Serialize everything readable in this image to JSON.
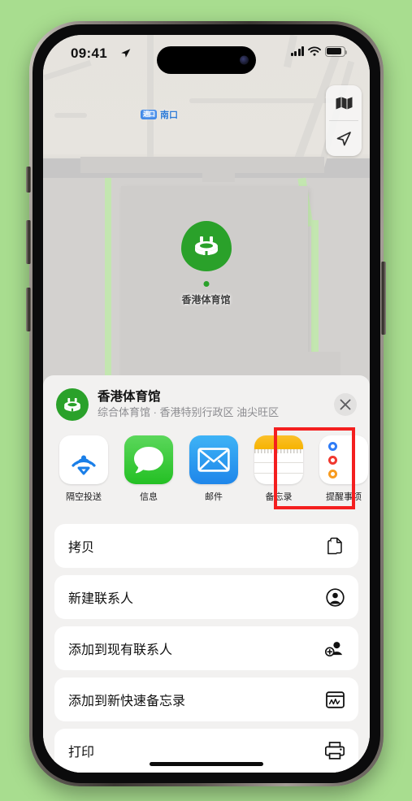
{
  "background_color": "#a8dd8f",
  "status_bar": {
    "time": "09:41",
    "location_arrow_icon": "location-arrow-icon",
    "signal_icon": "cellular-signal-icon",
    "wifi_icon": "wifi-icon",
    "battery_icon": "battery-icon"
  },
  "map": {
    "label": {
      "badge": "进口",
      "text": "南口",
      "color": "#2f7bd6"
    },
    "place_pin": {
      "label": "香港体育馆",
      "icon": "stadium-icon",
      "color": "#2aa12a"
    },
    "controls": [
      {
        "name": "map-style-button",
        "icon": "folded-map-icon"
      },
      {
        "name": "user-location-button",
        "icon": "navigation-arrow-icon"
      }
    ]
  },
  "share_sheet": {
    "header": {
      "icon": "stadium-icon",
      "title": "香港体育馆",
      "subtitle": "综合体育馆 · 香港特别行政区 油尖旺区",
      "close_label": "✕"
    },
    "apps": [
      {
        "label": "隔空投送",
        "icon": "airdrop-icon",
        "highlighted": false
      },
      {
        "label": "信息",
        "icon": "messages-icon",
        "highlighted": false
      },
      {
        "label": "邮件",
        "icon": "mail-icon",
        "highlighted": false
      },
      {
        "label": "备忘录",
        "icon": "notes-icon",
        "highlighted": true
      },
      {
        "label": "提醒事项",
        "icon": "reminders-icon",
        "highlighted": false
      }
    ],
    "highlight_color": "#f41f1f",
    "actions": [
      {
        "label": "拷贝",
        "icon": "copy-icon"
      },
      {
        "label": "新建联系人",
        "icon": "person-circle-icon"
      },
      {
        "label": "添加到现有联系人",
        "icon": "person-add-icon"
      },
      {
        "label": "添加到新快速备忘录",
        "icon": "quick-note-icon"
      },
      {
        "label": "打印",
        "icon": "printer-icon"
      }
    ]
  }
}
